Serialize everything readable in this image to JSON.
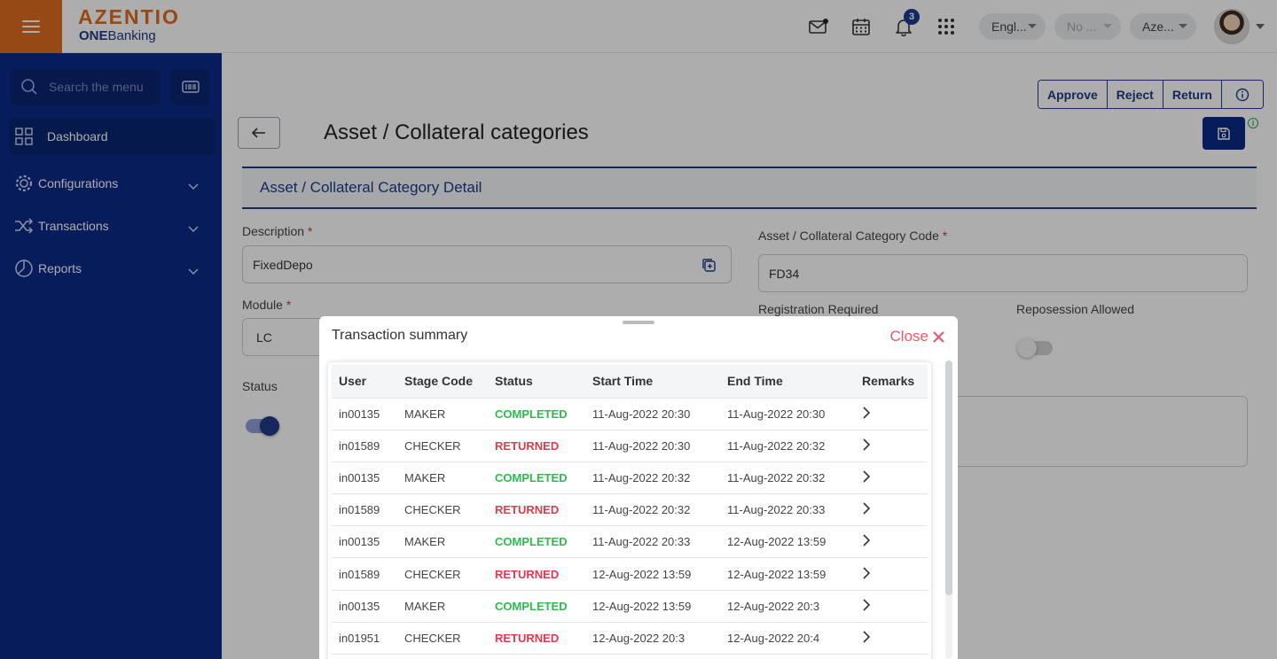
{
  "brand": {
    "name": "AZENTIO",
    "sub_bold": "ONE",
    "sub_rest": "Banking"
  },
  "topbar": {
    "notification_count": "3",
    "language": "Engl...",
    "selector_2": "No ...",
    "selector_3": "Aze..."
  },
  "sidebar": {
    "search_placeholder": "Search the menu",
    "items": [
      {
        "label": "Dashboard",
        "icon": "dashboard-grid-icon"
      },
      {
        "label": "Configurations",
        "icon": "gear-icon"
      },
      {
        "label": "Transactions",
        "icon": "shuffle-icon"
      },
      {
        "label": "Reports",
        "icon": "pie-chart-icon"
      }
    ]
  },
  "toolbar": {
    "approve": "Approve",
    "reject": "Reject",
    "return": "Return"
  },
  "page": {
    "title": "Asset / Collateral categories",
    "section_title": "Asset / Collateral Category Detail"
  },
  "form": {
    "description_label": "Description",
    "description_value": "FixedDepo",
    "module_label": "Module",
    "module_value": "LC",
    "status_label": "Status",
    "category_code_label": "Asset / Collateral Category Code",
    "category_code_value": "FD34",
    "registration_label": "Registration Required",
    "repossession_label": "Reposession Allowed",
    "required_mark": "*"
  },
  "modal": {
    "title": "Transaction summary",
    "close_label": "Close",
    "columns": [
      "User",
      "Stage Code",
      "Status",
      "Start Time",
      "End Time",
      "Remarks"
    ],
    "rows": [
      {
        "user": "in00135",
        "stage": "MAKER",
        "status": "COMPLETED",
        "start": "11-Aug-2022 20:30",
        "end": "11-Aug-2022 20:30"
      },
      {
        "user": "in01589",
        "stage": "CHECKER",
        "status": "RETURNED",
        "start": "11-Aug-2022 20:30",
        "end": "11-Aug-2022 20:32"
      },
      {
        "user": "in00135",
        "stage": "MAKER",
        "status": "COMPLETED",
        "start": "11-Aug-2022 20:32",
        "end": "11-Aug-2022 20:32"
      },
      {
        "user": "in01589",
        "stage": "CHECKER",
        "status": "RETURNED",
        "start": "11-Aug-2022 20:32",
        "end": "11-Aug-2022 20:33"
      },
      {
        "user": "in00135",
        "stage": "MAKER",
        "status": "COMPLETED",
        "start": "11-Aug-2022 20:33",
        "end": "12-Aug-2022 13:59"
      },
      {
        "user": "in01589",
        "stage": "CHECKER",
        "status": "RETURNED",
        "start": "12-Aug-2022 13:59",
        "end": "12-Aug-2022 13:59"
      },
      {
        "user": "in00135",
        "stage": "MAKER",
        "status": "COMPLETED",
        "start": "12-Aug-2022 13:59",
        "end": "12-Aug-2022 20:3"
      },
      {
        "user": "in01951",
        "stage": "CHECKER",
        "status": "RETURNED",
        "start": "12-Aug-2022 20:3",
        "end": "12-Aug-2022 20:4"
      }
    ]
  },
  "colors": {
    "brand_orange": "#dd6b20",
    "sidebar_blue": "#0b2a85",
    "completed_green": "#2dbb4e",
    "returned_red": "#e03950",
    "close_red": "#e8596b"
  }
}
